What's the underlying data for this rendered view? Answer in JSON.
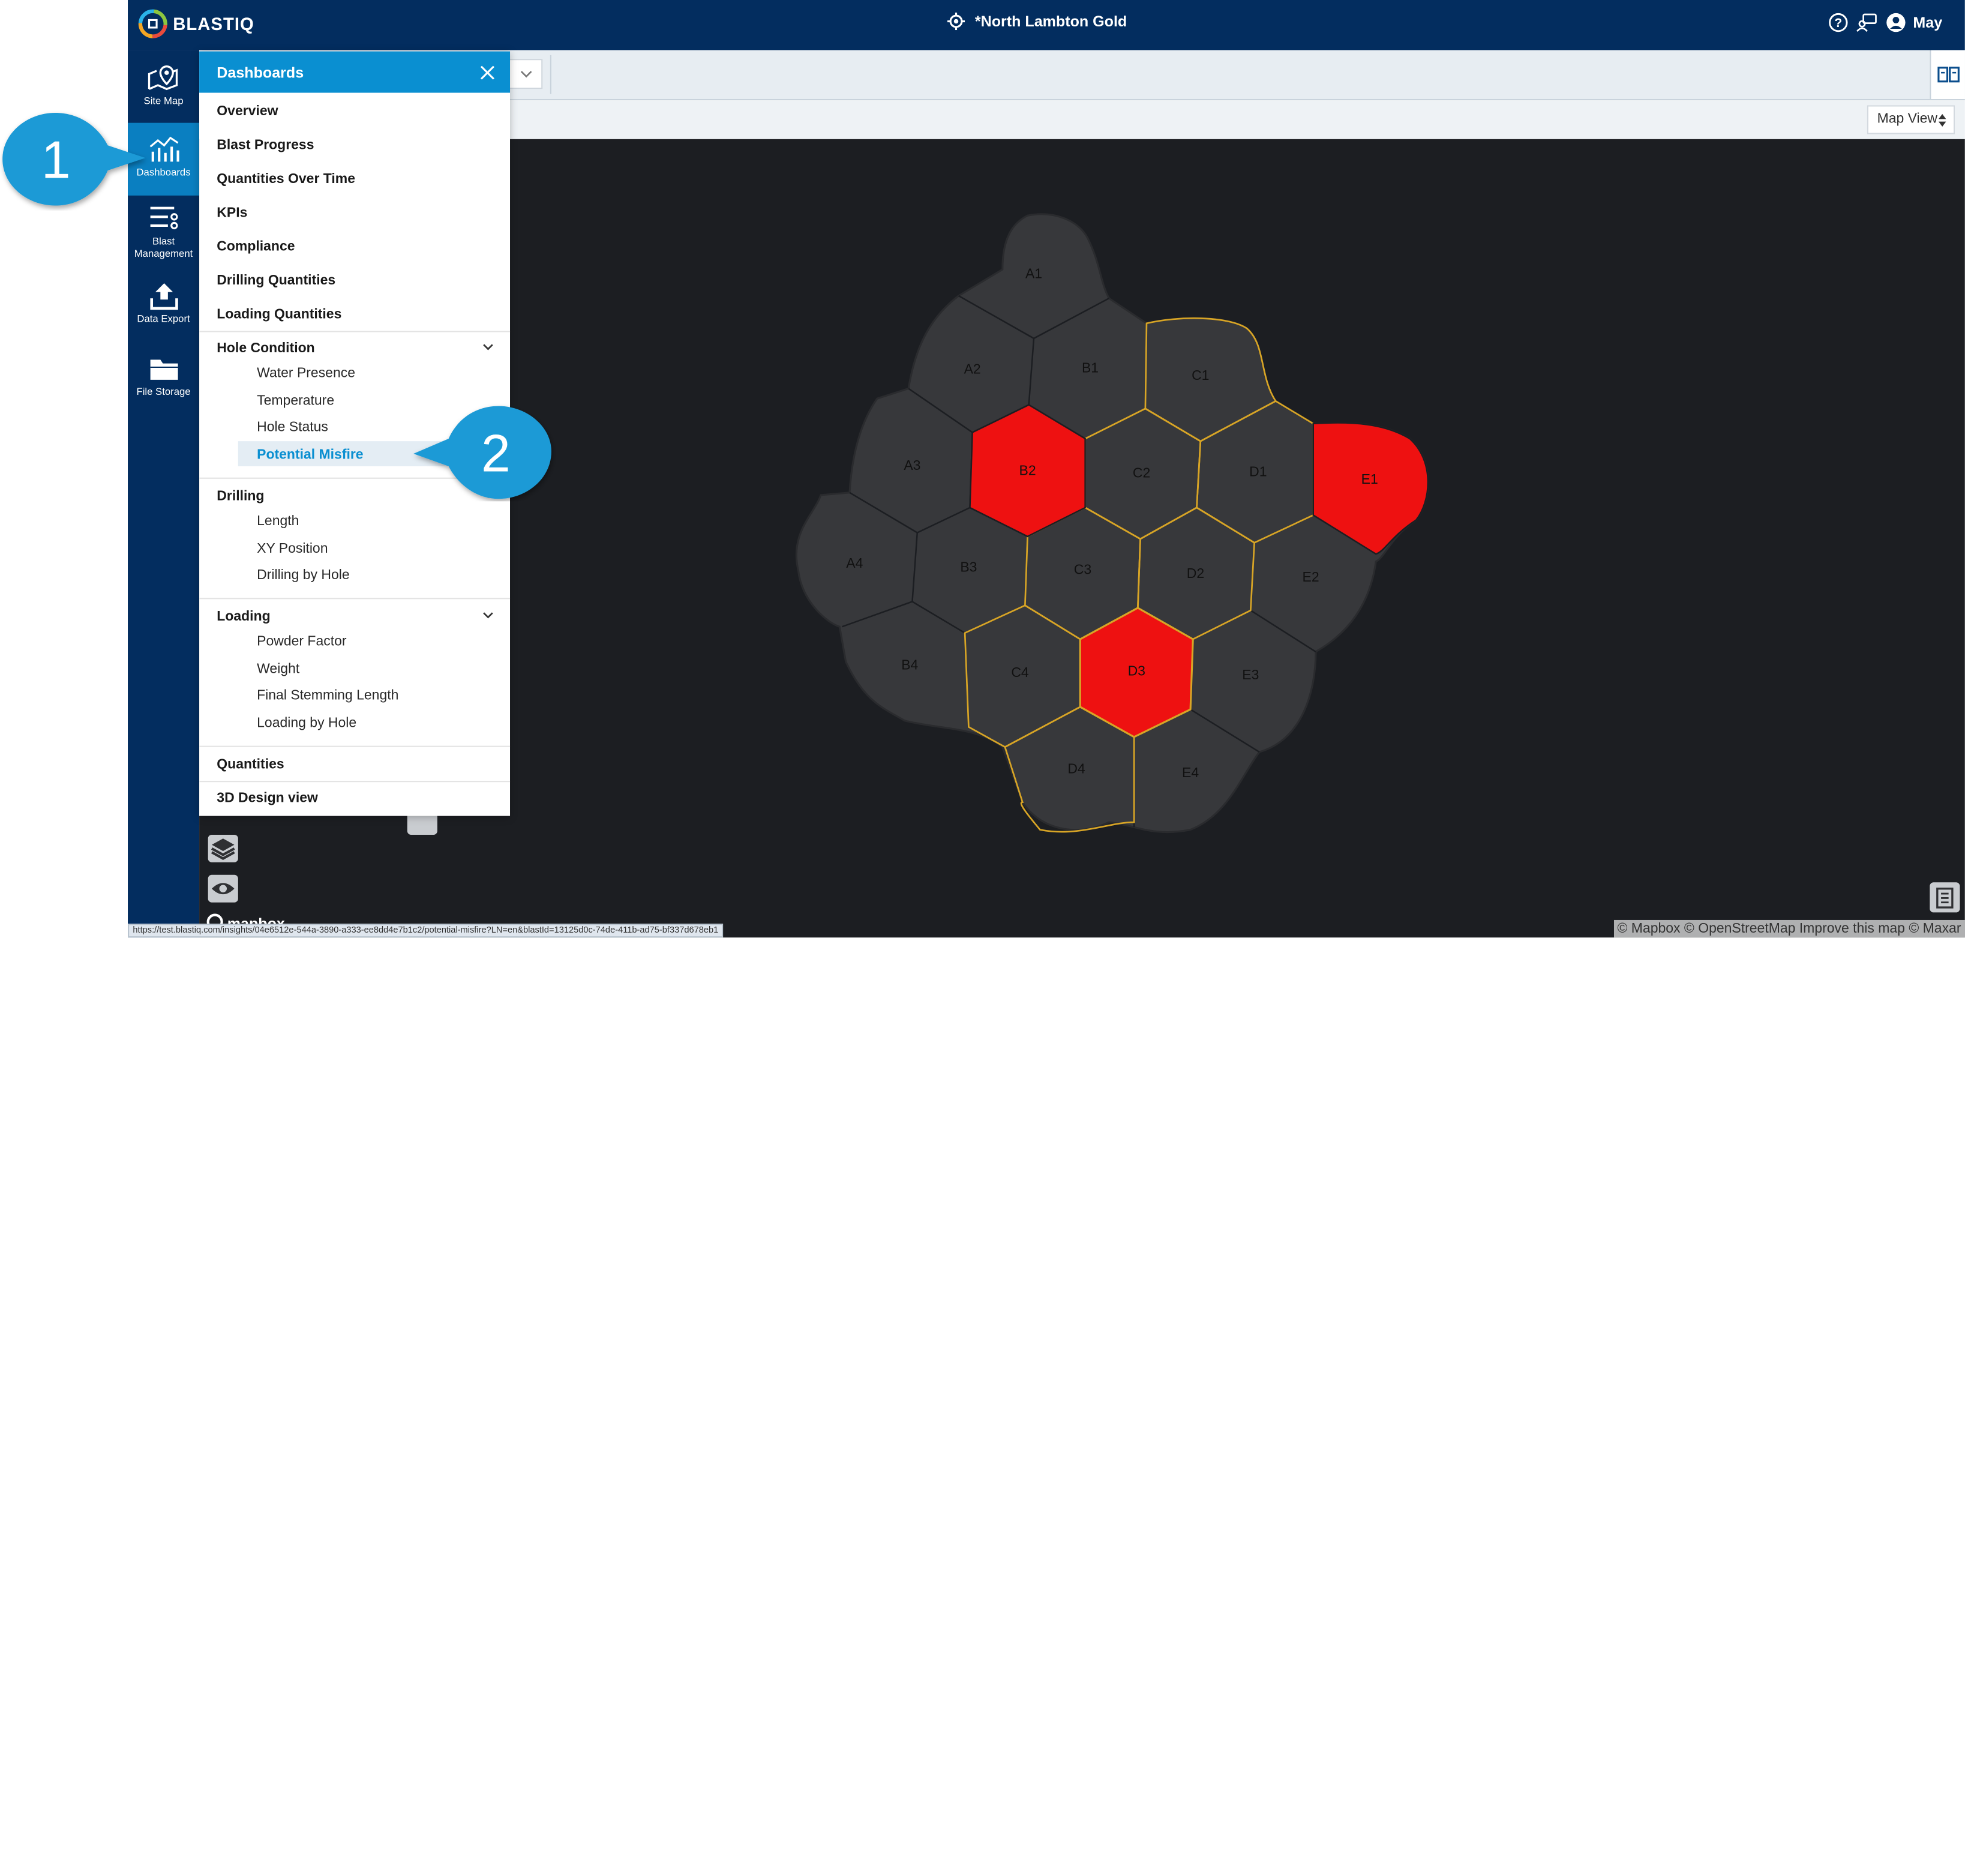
{
  "app": {
    "logo_text": "BLASTIQ",
    "site_name": "*North Lambton Gold",
    "user_name": "May"
  },
  "left_nav": [
    {
      "label": "Site Map",
      "icon": "map-icon"
    },
    {
      "label": "Dashboards",
      "icon": "chart-icon",
      "active": true
    },
    {
      "label": "Blast Management",
      "icon": "list-icon"
    },
    {
      "label": "Data Export",
      "icon": "upload-icon"
    },
    {
      "label": "File Storage",
      "icon": "folder-icon"
    }
  ],
  "map_view": {
    "selected": "Map View"
  },
  "menu": {
    "title": "Dashboards",
    "items": [
      "Overview",
      "Blast Progress",
      "Quantities Over Time",
      "KPIs",
      "Compliance",
      "Drilling Quantities",
      "Loading Quantities"
    ],
    "groups": [
      {
        "label": "Hole Condition",
        "children": [
          "Water Presence",
          "Temperature",
          "Hole Status",
          "Potential Misfire"
        ],
        "selected": "Potential Misfire"
      },
      {
        "label": "Drilling",
        "children": [
          "Length",
          "XY Position",
          "Drilling by Hole"
        ]
      },
      {
        "label": "Loading",
        "children": [
          "Powder Factor",
          "Weight",
          "Final Stemming Length",
          "Loading by Hole"
        ]
      }
    ],
    "bottom_items": [
      "Quantities",
      "3D Design view"
    ]
  },
  "callouts": [
    "1",
    "2"
  ],
  "map_cells": [
    {
      "label": "A1",
      "state": "normal"
    },
    {
      "label": "A2",
      "state": "normal"
    },
    {
      "label": "B1",
      "state": "normal"
    },
    {
      "label": "C1",
      "state": "highlighted"
    },
    {
      "label": "A3",
      "state": "normal"
    },
    {
      "label": "B2",
      "state": "misfire"
    },
    {
      "label": "C2",
      "state": "highlighted"
    },
    {
      "label": "D1",
      "state": "highlighted"
    },
    {
      "label": "E1",
      "state": "misfire"
    },
    {
      "label": "A4",
      "state": "normal"
    },
    {
      "label": "B3",
      "state": "normal"
    },
    {
      "label": "C3",
      "state": "highlighted"
    },
    {
      "label": "D2",
      "state": "highlighted"
    },
    {
      "label": "E2",
      "state": "normal"
    },
    {
      "label": "B4",
      "state": "normal"
    },
    {
      "label": "C4",
      "state": "highlighted"
    },
    {
      "label": "D3",
      "state": "misfire"
    },
    {
      "label": "E3",
      "state": "normal"
    },
    {
      "label": "D4",
      "state": "highlighted"
    },
    {
      "label": "E4",
      "state": "normal"
    }
  ],
  "colors": {
    "nav": "#032d5f",
    "accent": "#0a8fd1",
    "misfire": "#ee1111",
    "cell": "#37383b",
    "highlight": "#d8a526"
  },
  "attribution": "© Mapbox © OpenStreetMap Improve this map © Maxar",
  "mapbox_logo": "mapbox",
  "status_url": "https://test.blastiq.com/insights/04e6512e-544a-3890-a333-ee8dd4e7b1c2/potential-misfire?LN=en&blastId=13125d0c-74de-411b-ad75-bf337d678eb1"
}
